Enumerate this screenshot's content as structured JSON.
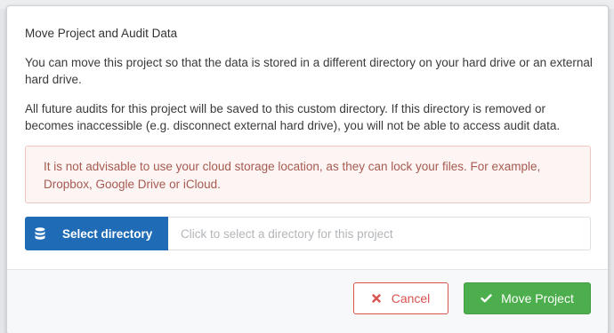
{
  "dialog": {
    "title": "Move Project and Audit Data",
    "paragraph_1": "You can move this project so that the data is stored in a different directory on your hard drive or an external hard drive.",
    "paragraph_2": "All future audits for this project will be saved to this custom directory. If this directory is removed or becomes inaccessible (e.g. disconnect external hard drive), you will not be able to access audit data.",
    "warning": "It is not advisable to use your cloud storage location, as they can lock your files. For example, Dropbox, Google Drive or iCloud."
  },
  "directory_picker": {
    "button_label": "Select directory",
    "button_icon": "database-icon",
    "input_value": "",
    "input_placeholder": "Click to select a directory for this project"
  },
  "footer": {
    "cancel_label": "Cancel",
    "cancel_icon": "close-icon",
    "move_label": "Move Project",
    "move_icon": "check-icon"
  },
  "colors": {
    "primary_blue": "#1f6bb5",
    "success_green": "#4cae4c",
    "danger_red": "#d9534f",
    "warning_bg": "#fdf5f3",
    "warning_text": "#a65a51"
  }
}
